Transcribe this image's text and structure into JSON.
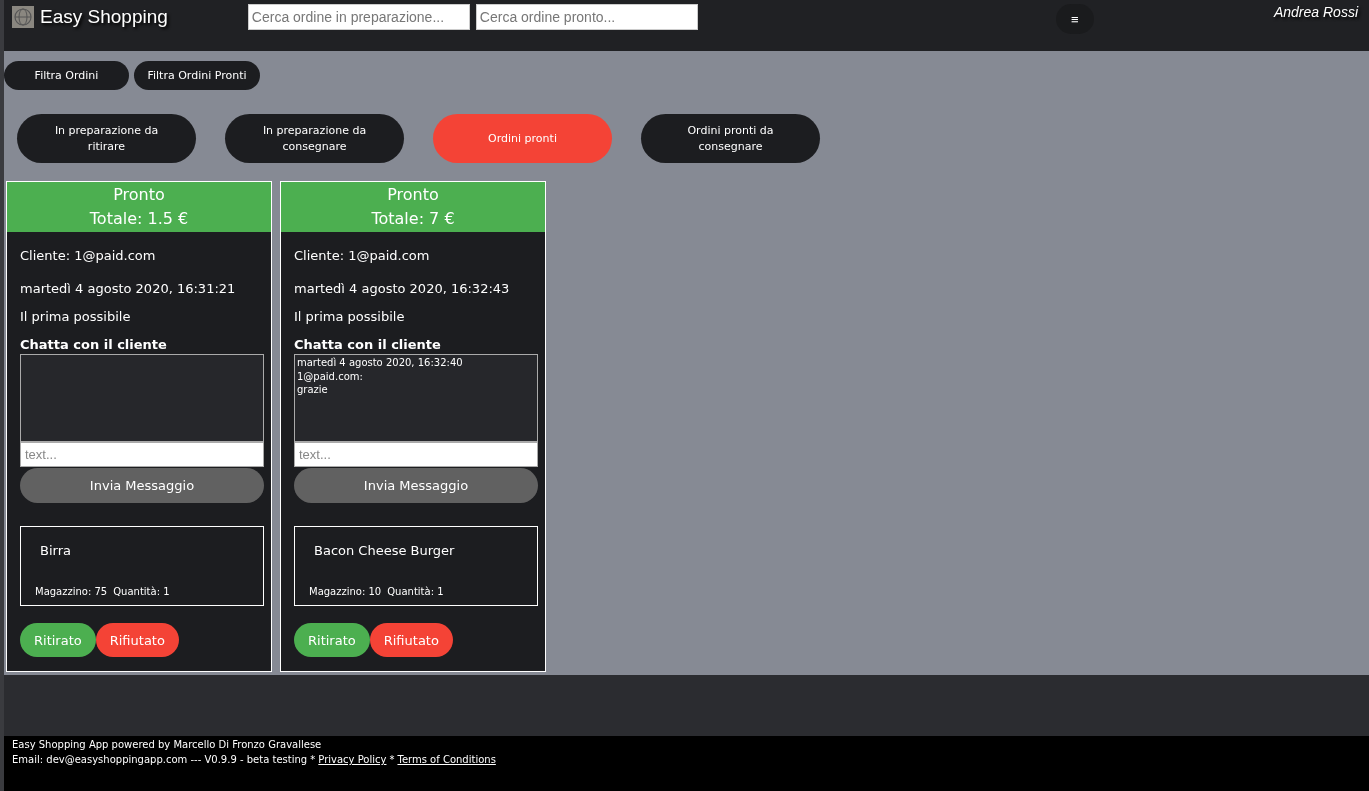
{
  "header": {
    "brand": "Easy Shopping",
    "search_preparing": {
      "placeholder": "Cerca ordine in preparazione..."
    },
    "search_ready": {
      "placeholder": "Cerca ordine pronto..."
    },
    "menu_glyph": "≡",
    "user": "Andrea Rossi"
  },
  "filters": [
    "Filtra Ordini",
    "Filtra Ordini Pronti"
  ],
  "status_tabs": [
    {
      "label": "In preparazione da ritirare",
      "selected": false
    },
    {
      "label": "In preparazione da consegnare",
      "selected": false
    },
    {
      "label": "Ordini pronti",
      "selected": true
    },
    {
      "label": "Ordini pronti da consegnare",
      "selected": false
    }
  ],
  "orders": [
    {
      "status": "Pronto",
      "total": "Totale: 1.5 €",
      "customer": "Cliente: 1@paid.com",
      "date": "martedì 4 agosto 2020, 16:31:21",
      "timing": "Il prima possibile",
      "chat_title": "Chatta con il cliente",
      "message": {
        "placeholder": "text..."
      },
      "send": "Invia Messaggio",
      "items": [
        {
          "name": "Birra",
          "stock": "Magazzino: 75",
          "quantity": "Quantità: 1"
        }
      ],
      "actions": [
        {
          "label": "Ritirato",
          "kind": "accept"
        },
        {
          "label": "Rifiutato",
          "kind": "reject"
        }
      ]
    },
    {
      "status": "Pronto",
      "total": "Totale: 7 €",
      "customer": "Cliente: 1@paid.com",
      "date": "martedì 4 agosto 2020, 16:32:43",
      "timing": "Il prima possibile",
      "chat_title": "Chatta con il cliente",
      "chat_lines": [
        "martedì 4 agosto 2020, 16:32:40",
        "1@paid.com:",
        "grazie"
      ],
      "message": {
        "placeholder": "text..."
      },
      "send": "Invia Messaggio",
      "items": [
        {
          "name": "Bacon Cheese Burger",
          "stock": "Magazzino: 10",
          "quantity": "Quantità: 1"
        }
      ],
      "actions": [
        {
          "label": "Ritirato",
          "kind": "accept"
        },
        {
          "label": "Rifiutato",
          "kind": "reject"
        }
      ]
    }
  ],
  "footer": {
    "credit": "Easy Shopping App powered by Marcello Di Fronzo Gravallese",
    "contact": "Email: dev@easyshoppingapp.com --- V0.9.9 - beta testing *",
    "privacy": "Privacy Policy",
    "separator": "*",
    "terms": "Terms of Conditions"
  }
}
